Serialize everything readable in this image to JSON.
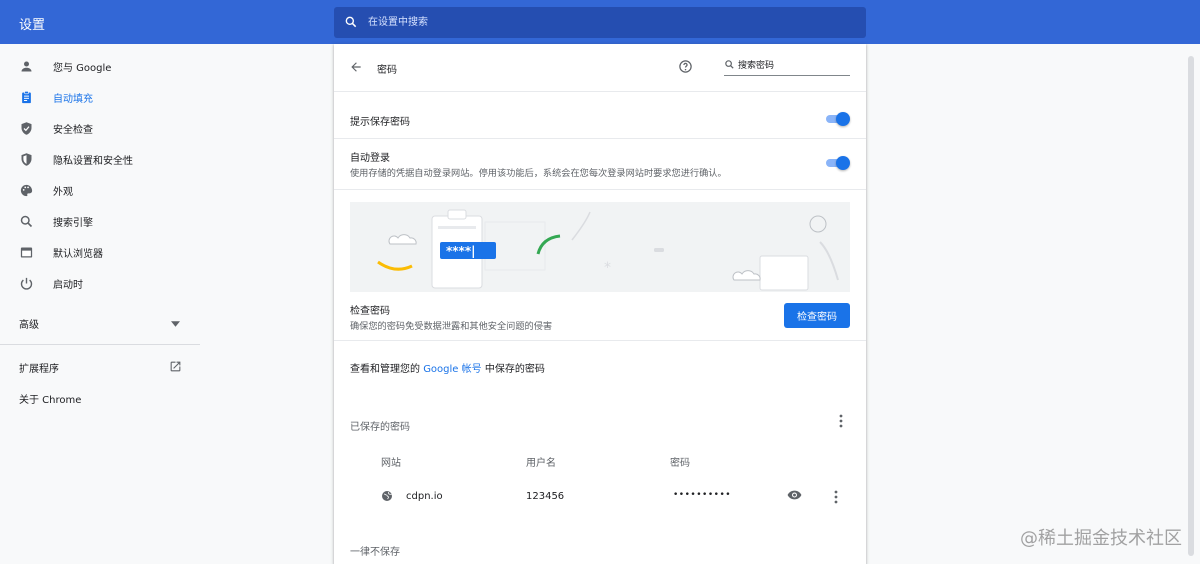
{
  "header": {
    "title": "设置",
    "search_placeholder": "在设置中搜索"
  },
  "sidebar": {
    "items": [
      {
        "label": "您与 Google",
        "icon": "person-icon"
      },
      {
        "label": "自动填充",
        "icon": "clipboard-icon",
        "active": true
      },
      {
        "label": "安全检查",
        "icon": "shield-check-icon"
      },
      {
        "label": "隐私设置和安全性",
        "icon": "shield-icon"
      },
      {
        "label": "外观",
        "icon": "palette-icon"
      },
      {
        "label": "搜索引擎",
        "icon": "search-icon"
      },
      {
        "label": "默认浏览器",
        "icon": "browser-icon"
      },
      {
        "label": "启动时",
        "icon": "power-icon"
      }
    ],
    "advanced_label": "高级",
    "extensions_label": "扩展程序",
    "about_label": "关于 Chrome"
  },
  "passwords": {
    "page_title": "密码",
    "search_placeholder": "搜索密码",
    "offer_save_label": "提示保存密码",
    "offer_save_enabled": true,
    "autosignin_label": "自动登录",
    "autosignin_desc": "使用存储的凭据自动登录网站。停用该功能后，系统会在您每次登录网站时要求您进行确认。",
    "autosignin_enabled": true,
    "illustration_text": "****|",
    "check_title": "检查密码",
    "check_desc": "确保您的密码免受数据泄露和其他安全问题的侵害",
    "check_button": "检查密码",
    "manage_prefix": "查看和管理您的",
    "manage_link": "Google 帐号",
    "manage_suffix": "中保存的密码",
    "saved_title": "已保存的密码",
    "columns": [
      "网站",
      "用户名",
      "密码"
    ],
    "rows": [
      {
        "site": "cdpn.io",
        "username": "123456",
        "password": "••••••••••"
      }
    ],
    "never_saved_title": "一律不保存"
  },
  "watermark": "@稀土掘金技术社区",
  "colors": {
    "accent": "#1a73e8",
    "header_bg": "#3367d6",
    "search_bg": "#254eb1"
  }
}
